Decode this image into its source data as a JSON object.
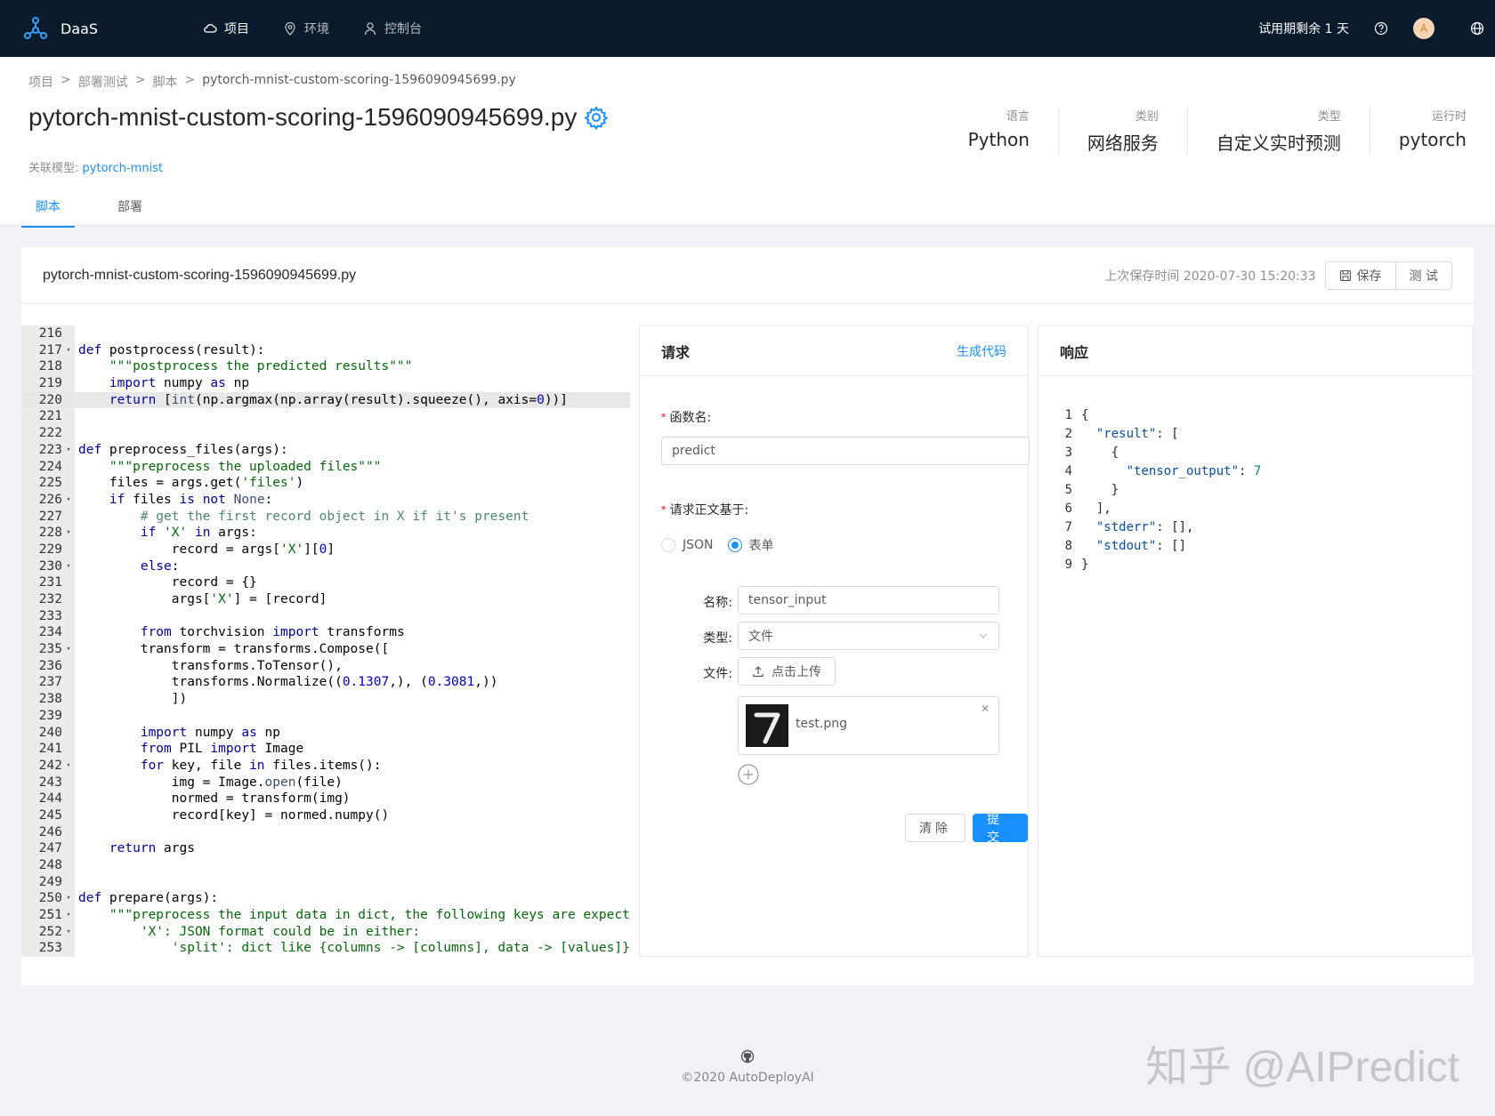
{
  "app": {
    "brand": "DaaS",
    "nav": [
      {
        "label": "项目",
        "icon": "cloud-icon"
      },
      {
        "label": "环境",
        "icon": "location-pin-icon"
      },
      {
        "label": "控制台",
        "icon": "user-icon"
      }
    ],
    "trial": "试用期剩余 1 天",
    "avatar_letter": "A"
  },
  "breadcrumb": [
    "项目",
    "部署测试",
    "脚本",
    "pytorch-mnist-custom-scoring-1596090945699.py"
  ],
  "page": {
    "title": "pytorch-mnist-custom-scoring-1596090945699.py",
    "linked_label": "关联模型:",
    "linked_model": "pytorch-mnist",
    "stats": [
      {
        "label": "语言",
        "value": "Python"
      },
      {
        "label": "类别",
        "value": "网络服务"
      },
      {
        "label": "类型",
        "value": "自定义实时预测"
      },
      {
        "label": "运行时",
        "value": "pytorch"
      }
    ],
    "tabs": [
      {
        "label": "脚本",
        "active": true
      },
      {
        "label": "部署",
        "active": false
      }
    ]
  },
  "card": {
    "title": "pytorch-mnist-custom-scoring-1596090945699.py",
    "saved_time": "上次保存时间 2020-07-30 15:20:33",
    "save_label": "保存",
    "test_label": "测 试"
  },
  "code": {
    "highlight_line": 220,
    "lines": [
      {
        "n": 216,
        "fold": false,
        "html": ""
      },
      {
        "n": 217,
        "fold": true,
        "html": "<span class='kw'>def</span> postprocess(result):"
      },
      {
        "n": 218,
        "fold": false,
        "html": "    <span class='str'>\"\"\"postprocess the predicted results\"\"\"</span>"
      },
      {
        "n": 219,
        "fold": false,
        "html": "    <span class='kw'>import</span> numpy <span class='kw'>as</span> np"
      },
      {
        "n": 220,
        "fold": false,
        "html": "    <span class='kw'>return</span> [<span class='bi'>int</span>(np.argmax(np.array(result).squeeze(), axis=<span class='num'>0</span>))]"
      },
      {
        "n": 221,
        "fold": false,
        "html": ""
      },
      {
        "n": 222,
        "fold": false,
        "html": ""
      },
      {
        "n": 223,
        "fold": true,
        "html": "<span class='kw'>def</span> preprocess_files(args):"
      },
      {
        "n": 224,
        "fold": false,
        "html": "    <span class='str'>\"\"\"preprocess the uploaded files\"\"\"</span>"
      },
      {
        "n": 225,
        "fold": false,
        "html": "    files = args.get(<span class='str'>'files'</span>)"
      },
      {
        "n": 226,
        "fold": true,
        "html": "    <span class='kw'>if</span> files <span class='kw'>is not</span> <span class='bi'>None</span>:"
      },
      {
        "n": 227,
        "fold": false,
        "html": "        <span class='cm'># get the first record object in X if it's present</span>"
      },
      {
        "n": 228,
        "fold": true,
        "html": "        <span class='kw'>if</span> <span class='str'>'X'</span> <span class='kw'>in</span> args:"
      },
      {
        "n": 229,
        "fold": false,
        "html": "            record = args[<span class='str'>'X'</span>][<span class='num'>0</span>]"
      },
      {
        "n": 230,
        "fold": true,
        "html": "        <span class='kw'>else</span>:"
      },
      {
        "n": 231,
        "fold": false,
        "html": "            record = {}"
      },
      {
        "n": 232,
        "fold": false,
        "html": "            args[<span class='str'>'X'</span>] = [record]"
      },
      {
        "n": 233,
        "fold": false,
        "html": ""
      },
      {
        "n": 234,
        "fold": false,
        "html": "        <span class='kw'>from</span> torchvision <span class='kw'>import</span> transforms"
      },
      {
        "n": 235,
        "fold": true,
        "html": "        transform = transforms.Compose(["
      },
      {
        "n": 236,
        "fold": false,
        "html": "            transforms.ToTensor(),"
      },
      {
        "n": 237,
        "fold": false,
        "html": "            transforms.Normalize((<span class='num'>0.1307</span>,), (<span class='num'>0.3081</span>,))"
      },
      {
        "n": 238,
        "fold": false,
        "html": "            ])"
      },
      {
        "n": 239,
        "fold": false,
        "html": ""
      },
      {
        "n": 240,
        "fold": false,
        "html": "        <span class='kw'>import</span> numpy <span class='kw'>as</span> np"
      },
      {
        "n": 241,
        "fold": false,
        "html": "        <span class='kw'>from</span> PIL <span class='kw'>import</span> Image"
      },
      {
        "n": 242,
        "fold": true,
        "html": "        <span class='kw'>for</span> key, file <span class='kw'>in</span> files.items():"
      },
      {
        "n": 243,
        "fold": false,
        "html": "            img = Image.<span class='bi'>open</span>(file)"
      },
      {
        "n": 244,
        "fold": false,
        "html": "            normed = transform(img)"
      },
      {
        "n": 245,
        "fold": false,
        "html": "            record[key] = normed.numpy()"
      },
      {
        "n": 246,
        "fold": false,
        "html": ""
      },
      {
        "n": 247,
        "fold": false,
        "html": "    <span class='kw'>return</span> args"
      },
      {
        "n": 248,
        "fold": false,
        "html": ""
      },
      {
        "n": 249,
        "fold": false,
        "html": ""
      },
      {
        "n": 250,
        "fold": true,
        "html": "<span class='kw'>def</span> prepare(args):"
      },
      {
        "n": 251,
        "fold": true,
        "html": "    <span class='str'>\"\"\"preprocess the input data in dict, the following keys are expected:</span>"
      },
      {
        "n": 252,
        "fold": true,
        "html": "<span class='str'>        'X': JSON format could be in either:</span>"
      },
      {
        "n": 253,
        "fold": false,
        "html": "<span class='str'>            'split': dict like {columns -&gt; [columns], data -&gt; [values]}</span>"
      }
    ]
  },
  "request": {
    "title": "请求",
    "gen_code": "生成代码",
    "func_label": "函数名:",
    "func_value": "predict",
    "body_label": "请求正文基于:",
    "radio_json": "JSON",
    "radio_form": "表单",
    "selected": "表单",
    "name_label": "名称:",
    "name_value": "tensor_input",
    "type_label": "类型:",
    "type_value": "文件",
    "file_label": "文件:",
    "upload_label": "点击上传",
    "file_name": "test.png",
    "clear_label": "清除",
    "submit_label": "提交"
  },
  "response": {
    "title": "响应",
    "lines": [
      "{",
      "  \"result\": [",
      "    {",
      "      \"tensor_output\": 7",
      "    }",
      "  ],",
      "  \"stderr\": [],",
      "  \"stdout\": []",
      "}"
    ]
  },
  "footer": {
    "copyright": "©2020 AutoDeployAI",
    "watermark": "知乎 @AIPredict"
  }
}
